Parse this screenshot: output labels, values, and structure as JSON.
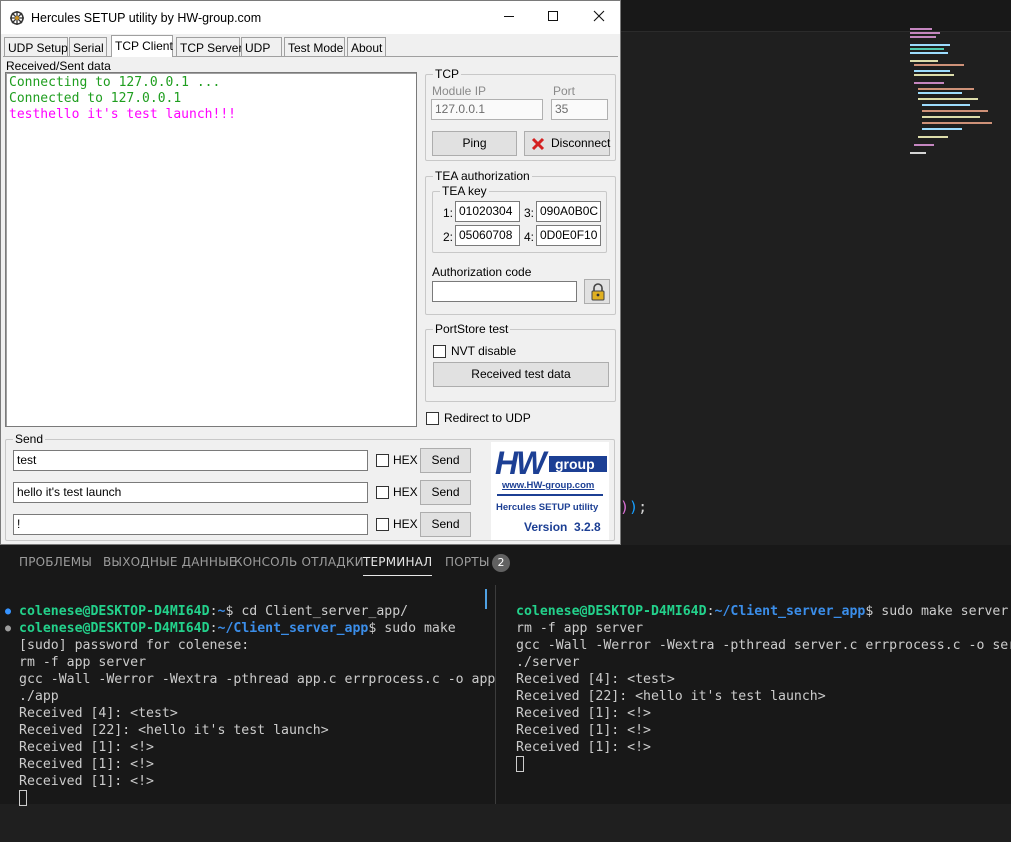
{
  "window": {
    "title": "Hercules SETUP utility by HW-group.com",
    "min_icon": "minimize-icon",
    "max_icon": "maximize-icon",
    "close_icon": "close-icon"
  },
  "tabs": [
    {
      "label": "UDP Setup"
    },
    {
      "label": "Serial"
    },
    {
      "label": "TCP Client",
      "active": true
    },
    {
      "label": "TCP Server"
    },
    {
      "label": "UDP"
    },
    {
      "label": "Test Mode"
    },
    {
      "label": "About"
    }
  ],
  "received": {
    "label": "Received/Sent data",
    "lines": [
      "Connecting to 127.0.0.1 ...",
      "Connected to 127.0.0.1",
      "testhello it's test launch!!!"
    ]
  },
  "tcp": {
    "group_label": "TCP",
    "module_ip_label": "Module IP",
    "module_ip": "127.0.0.1",
    "port_label": "Port",
    "port": "35",
    "ping_label": "Ping",
    "disconnect_label": "Disconnect"
  },
  "tea": {
    "group_label": "TEA authorization",
    "key_label": "TEA key",
    "keys": [
      {
        "n": "1:",
        "v": "01020304"
      },
      {
        "n": "3:",
        "v": "090A0B0C"
      },
      {
        "n": "2:",
        "v": "05060708"
      },
      {
        "n": "4:",
        "v": "0D0E0F10"
      }
    ],
    "auth_label": "Authorization code",
    "auth_value": ""
  },
  "portstore": {
    "group_label": "PortStore test",
    "nvt_label": "NVT disable",
    "received_btn": "Received test data"
  },
  "redirect_label": "Redirect to UDP",
  "send": {
    "group_label": "Send",
    "rows": [
      {
        "value": "test",
        "hex": "HEX",
        "btn": "Send"
      },
      {
        "value": "hello it's test launch",
        "hex": "HEX",
        "btn": "Send"
      },
      {
        "value": "!",
        "hex": "HEX",
        "btn": "Send"
      }
    ]
  },
  "logo": {
    "brand": "HWgroup",
    "url": "www.HW-group.com",
    "product": "Hercules SETUP utility",
    "version": "Version  3.2.8"
  },
  "panel": {
    "tabs": [
      "ПРОБЛЕМЫ",
      "ВЫХОДНЫЕ ДАННЫЕ",
      "КОНСОЛЬ ОТЛАДКИ",
      "ТЕРМИНАЛ",
      "ПОРТЫ"
    ],
    "ports_badge": "2"
  },
  "term_left": {
    "user": "colenese@DESKTOP-D4MI64D",
    "p1": "~",
    "cmd1": "$ cd Client_server_app/",
    "p2": "~/Client_server_app",
    "cmd2": "$ sudo make",
    "out": [
      "[sudo] password for colenese:",
      "rm -f app server",
      "gcc -Wall -Werror -Wextra -pthread app.c errprocess.c -o app",
      "./app",
      "Received [4]: <test>",
      "Received [22]: <hello it's test launch>",
      "Received [1]: <!>",
      "Received [1]: <!>",
      "Received [1]: <!>"
    ]
  },
  "term_right": {
    "user": "colenese@DESKTOP-D4MI64D",
    "p": "~/Client_server_app",
    "cmd": "$ sudo make server",
    "out": [
      "rm -f app server",
      "gcc -Wall -Werror -Wextra -pthread server.c errprocess.c -o server",
      "./server",
      "Received [4]: <test>",
      "Received [22]: <hello it's test launch>",
      "Received [1]: <!>",
      "Received [1]: <!>",
      "Received [1]: <!>"
    ]
  },
  "editor": {
    "code_fragment": "));"
  },
  "colors": {
    "green_text": "#1f9e1f",
    "magenta_text": "#ff00ff",
    "term_user": "#23d18b",
    "term_path": "#3b8eea",
    "logo_blue": "#1c3f94"
  }
}
